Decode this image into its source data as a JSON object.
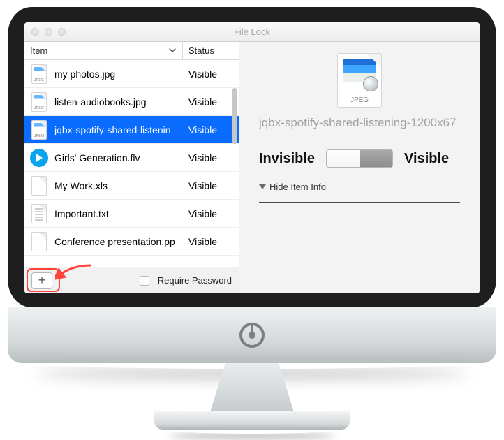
{
  "window": {
    "title": "File Lock"
  },
  "list": {
    "columns": {
      "item": "Item",
      "status": "Status"
    },
    "rows": [
      {
        "name": "my photos.jpg",
        "status": "Visible",
        "icon": "jpeg",
        "selected": false
      },
      {
        "name": "listen-audiobooks.jpg",
        "status": "Visible",
        "icon": "jpeg",
        "selected": false
      },
      {
        "name": "jqbx-spotify-shared-listenin",
        "status": "Visible",
        "icon": "jpeg",
        "selected": true
      },
      {
        "name": "Girls' Generation.flv",
        "status": "Visible",
        "icon": "flv",
        "selected": false
      },
      {
        "name": "My Work.xls",
        "status": "Visible",
        "icon": "blank",
        "selected": false
      },
      {
        "name": "Important.txt",
        "status": "Visible",
        "icon": "txt",
        "selected": false
      },
      {
        "name": "Conference presentation.pp",
        "status": "Visible",
        "icon": "blank",
        "selected": false
      }
    ]
  },
  "footer": {
    "add_label": "+",
    "require_password_label": "Require Password",
    "require_password_checked": false
  },
  "detail": {
    "type_label": "JPEG",
    "filename": "jqbx-spotify-shared-listening-1200x67",
    "invisible_label": "Invisible",
    "visible_label": "Visible",
    "toggle_state": "visible",
    "hide_info_label": "Hide Item Info"
  }
}
